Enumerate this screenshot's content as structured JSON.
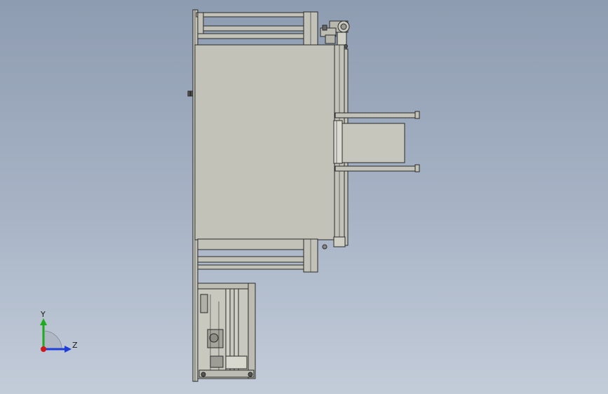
{
  "viewport": {
    "background_top": "#8e9cb1",
    "background_bottom": "#c3ccd9"
  },
  "model": {
    "part_fill": "#c2c2b8",
    "part_fill_light": "#d4d4cb",
    "edge_color": "#2a2a2a"
  },
  "triad": {
    "x_axis_color": "#d01818",
    "y_axis_color": "#1faa1f",
    "z_axis_color": "#1f3fd8",
    "y_label": "Y",
    "z_label": "Z"
  }
}
